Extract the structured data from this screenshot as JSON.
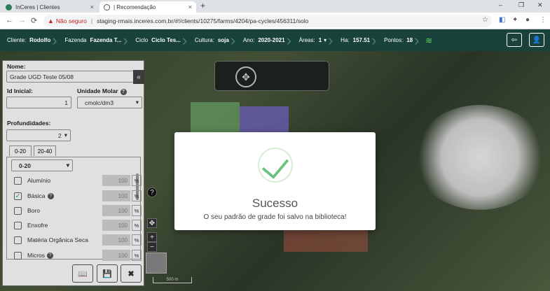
{
  "browser": {
    "tabs": [
      {
        "title": "InCeres | Clientes",
        "close": "×"
      },
      {
        "title": "| Recomendação",
        "close": "×"
      }
    ],
    "new_tab": "+",
    "window_controls": [
      "–",
      "❐",
      "✕"
    ],
    "nav": {
      "back": "←",
      "forward": "→",
      "reload": "⟳"
    },
    "address": {
      "warning": "Não seguro",
      "url": "staging-rmais.inceres.com.br/#!/clients/10275/farms/4204/pa-cycles/456311/solo"
    }
  },
  "appbar": {
    "cliente_label": "Cliente:",
    "cliente": "Rodolfo",
    "fazenda_label": "Fazenda",
    "fazenda": "Fazenda T...",
    "ciclo_label": "Ciclo",
    "ciclo": "Ciclo Tes...",
    "cultura_label": "Cultura:",
    "cultura": "soja",
    "ano_label": "Ano:",
    "ano": "2020-2021",
    "areas_label": "Áreas:",
    "areas": "1",
    "ha_label": "Ha:",
    "ha": "157.51",
    "pontos_label": "Pontos:",
    "pontos": "18"
  },
  "panel": {
    "nome_label": "Nome:",
    "nome": "Grade UGD Teste 05/08",
    "id_label": "Id Inicial:",
    "id_value": "1",
    "unidade_label": "Unidade Molar",
    "unidade_value": "cmolc/dm3",
    "prof_label": "Profundidades:",
    "prof_value": "2",
    "depth_tabs": [
      "0-20",
      "20-40"
    ],
    "depth_select": "0-20",
    "nutrients": [
      {
        "label": "Alumínio",
        "checked": false,
        "value": "100",
        "unit": "%"
      },
      {
        "label": "Básica",
        "checked": true,
        "value": "100",
        "unit": "%"
      },
      {
        "label": "Boro",
        "checked": false,
        "value": "100",
        "unit": "%"
      },
      {
        "label": "Enxofre",
        "checked": false,
        "value": "100",
        "unit": "%"
      },
      {
        "label": "Matéria Orgânica Seca",
        "checked": false,
        "value": "100",
        "unit": "%"
      },
      {
        "label": "Micros",
        "checked": false,
        "value": "100",
        "unit": "%"
      }
    ]
  },
  "map": {
    "scale": "500 m"
  },
  "modal": {
    "title": "Sucesso",
    "message": "O seu padrão de grade foi salvo na biblioteca!"
  },
  "colors": {
    "appbar": "#19433a",
    "success": "#69c37a"
  }
}
